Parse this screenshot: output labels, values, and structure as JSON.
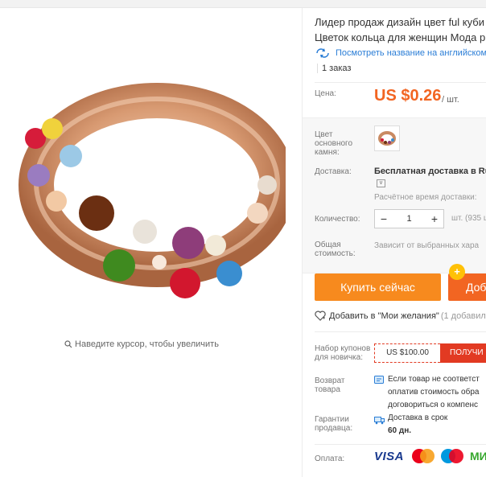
{
  "product": {
    "title_line1": "Лидер продаж дизайн цвет ful куби",
    "title_line2": "Цветок кольца для женщин Мода р",
    "translate_link": "Посмотреть название на английском",
    "orders": "1 заказ"
  },
  "gallery": {
    "zoom_hint": "Наведите курсор, чтобы увеличить",
    "image_icon": "jewel-ring-photo"
  },
  "price": {
    "label": "Цена:",
    "value": "US $0.26",
    "unit": "/ шт."
  },
  "attributes": {
    "color_label": "Цвет основного камня:",
    "shipping_label": "Доставка:",
    "shipping_value": "Бесплатная доставка в Ru",
    "shipping_estimate": "Расчётное время доставки:",
    "quantity_label": "Количество:",
    "quantity_value": "1",
    "quantity_unit": "шт. (935 ш",
    "total_label": "Общая стоимость:",
    "total_value": "Зависит от выбранных хара"
  },
  "actions": {
    "buy_now": "Купить сейчас",
    "add_to_cart": "Доба",
    "cart_badge": "+",
    "wishlist": "Добавить в \"Мои желания\"",
    "wishlist_count": "(1 добавил"
  },
  "coupon": {
    "label": "Набор купонов для новичка:",
    "amount": "US $100.00",
    "button": "ПОЛУЧИ"
  },
  "returns": {
    "label": "Возврат товара",
    "lines": [
      "Если товар не соответст",
      "оплатив стоимость обра",
      "договориться о компенс"
    ]
  },
  "guarantee": {
    "label": "Гарантии продавца:",
    "text": "Доставка в срок",
    "days": "60 дн."
  },
  "payment": {
    "label": "Оплата:",
    "methods": [
      "VISA",
      "MasterCard",
      "Maestro",
      "МИР"
    ],
    "mir_text": "МИ"
  },
  "colors": {
    "price": "#f26522",
    "buy_button": "#f78a1e",
    "cart_button": "#f26522",
    "link": "#2a7dd6",
    "coupon": "#e23a22"
  }
}
